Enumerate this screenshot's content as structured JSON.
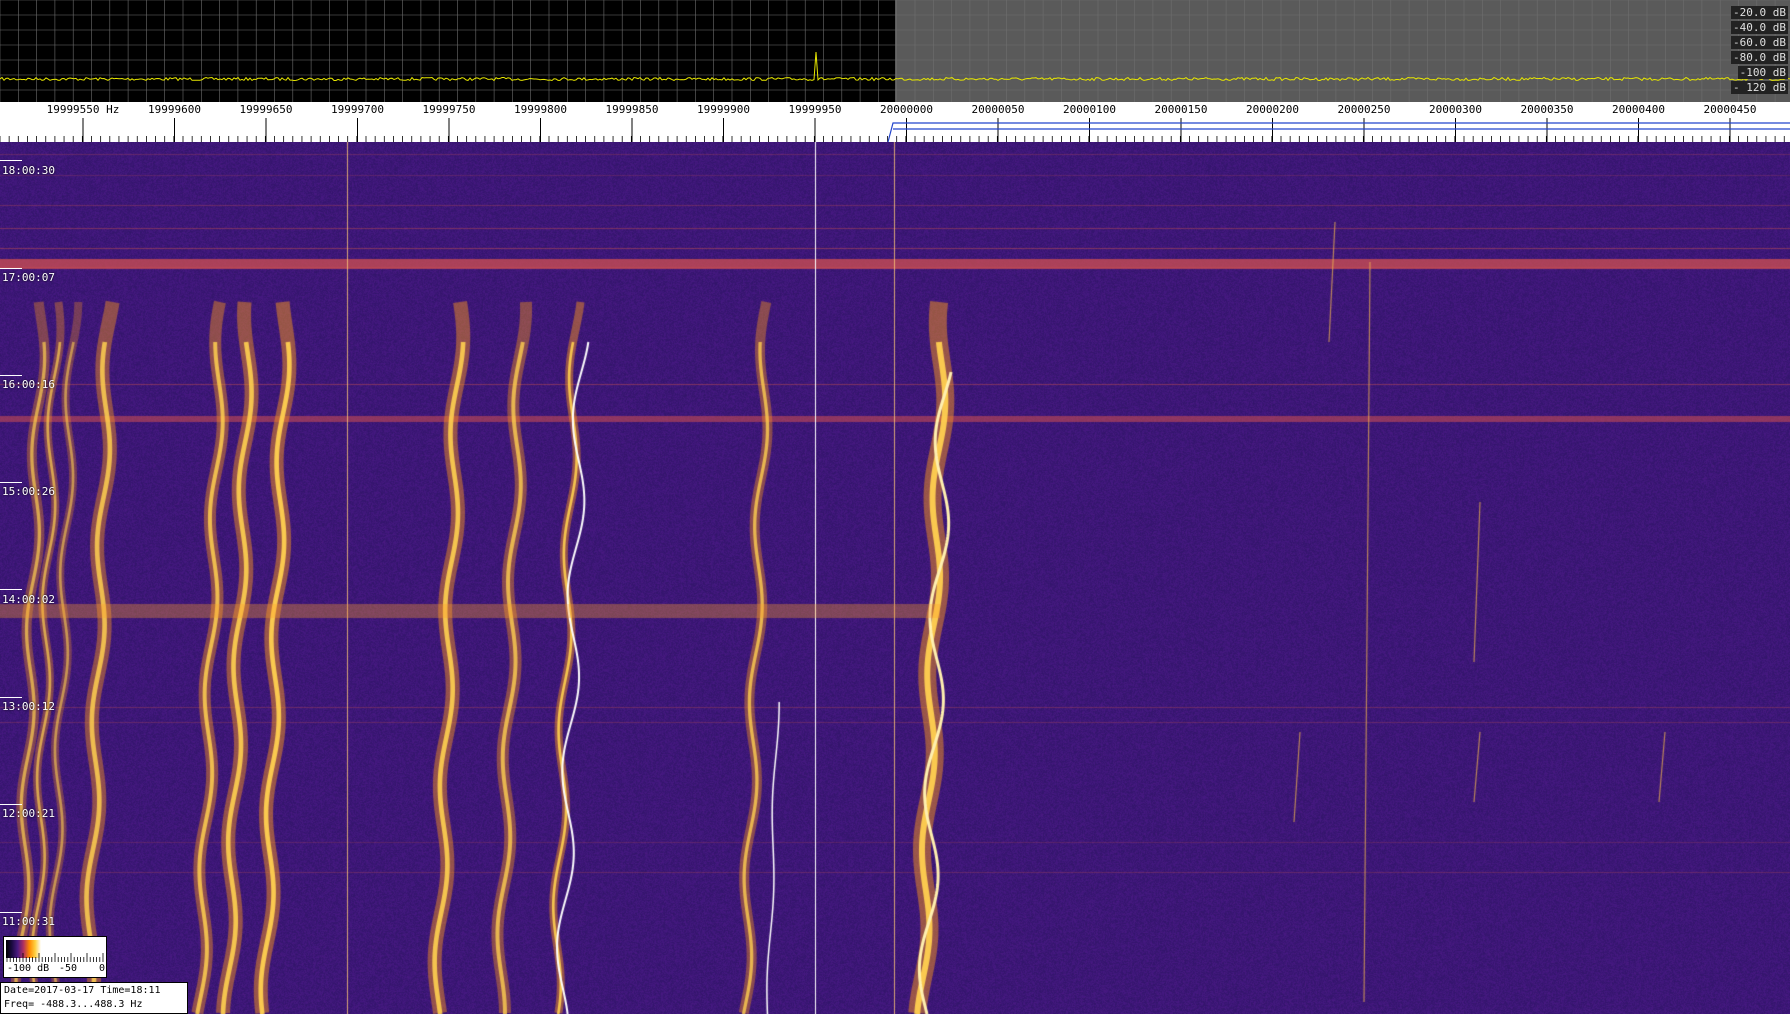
{
  "spectrum": {
    "db_scale": [
      "-20.0 dB",
      "-40.0 dB",
      "-60.0 dB",
      "-80.0 dB",
      "-100 dB",
      "- 120 dB"
    ]
  },
  "frequency_axis": {
    "unit_label": "Hz",
    "ticks": [
      "19999550",
      "19999600",
      "19999650",
      "19999700",
      "19999750",
      "19999800",
      "19999850",
      "19999900",
      "19999950",
      "20000000",
      "20000050",
      "20000100",
      "20000150",
      "20000200",
      "20000250",
      "20000300",
      "20000350",
      "20000400",
      "20000450"
    ]
  },
  "waterfall": {
    "time_labels": [
      "18:00:30",
      "17:00:07",
      "16:00:16",
      "15:00:26",
      "14:00:02",
      "13:00:12",
      "12:00:21",
      "11:00:31"
    ]
  },
  "colorbar": {
    "labels": [
      "-100 dB",
      "-50",
      "0"
    ]
  },
  "info": {
    "date_time": "Date=2017-03-17 Time=18:11",
    "freq_range": "Freq= -488.3...488.3 Hz"
  },
  "colors": {
    "background": "#3b1a7a",
    "signal": "#ffc830",
    "spectrum_trace": "#e8e800"
  }
}
